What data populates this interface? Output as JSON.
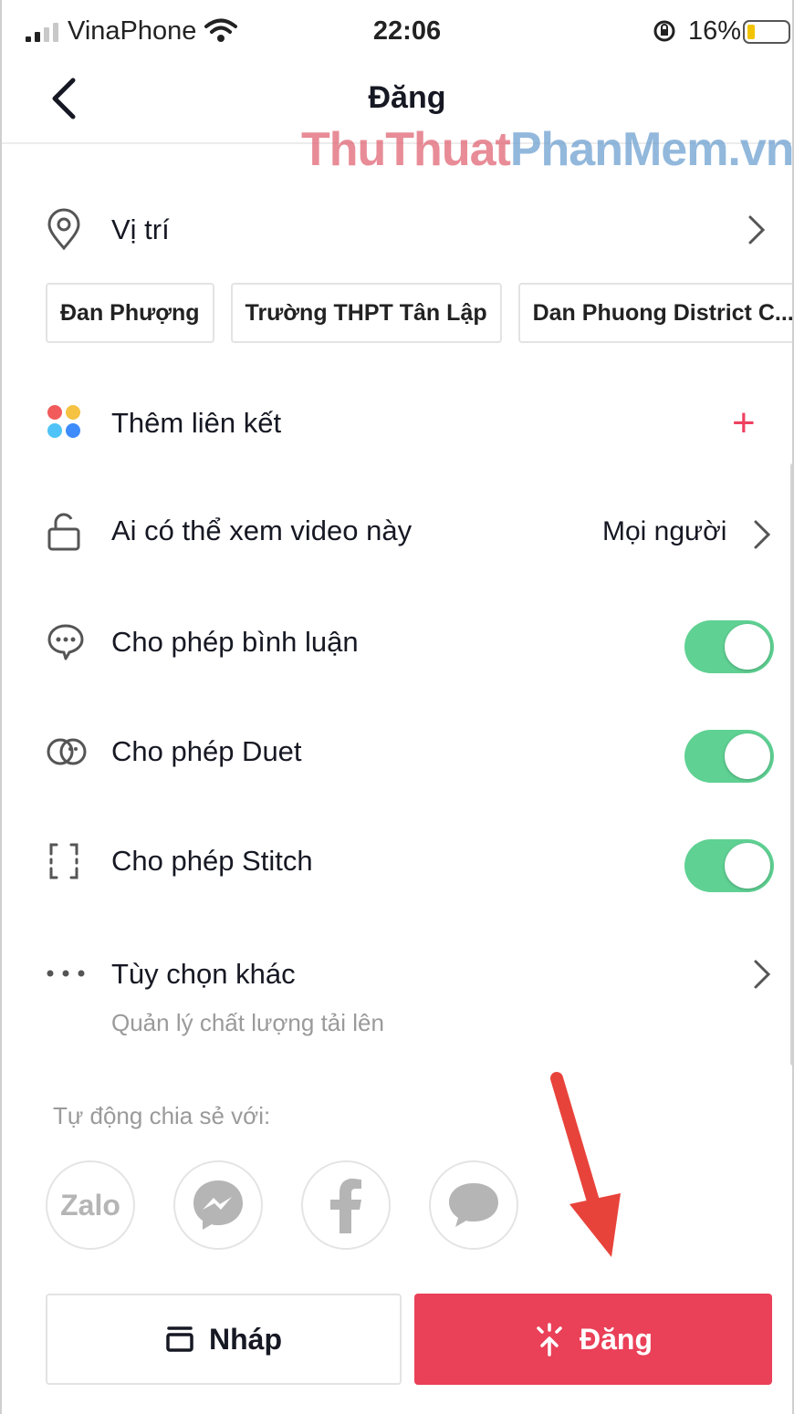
{
  "status_bar": {
    "carrier": "VinaPhone",
    "time": "22:06",
    "battery_percent": "16%",
    "battery_level": 0.16
  },
  "nav": {
    "title": "Đăng",
    "back_icon": "chevron-left-icon"
  },
  "watermark": {
    "part1": "ThuThuat",
    "part2": "PhanMem.vn"
  },
  "location": {
    "label": "Vị trí",
    "icon": "location-pin-icon",
    "suggestions": [
      "Đan Phượng",
      "Trường THPT Tân Lập",
      "Dan Phuong District C..."
    ]
  },
  "add_link": {
    "label": "Thêm liên kết",
    "icon": "colored-dots-icon",
    "action_icon": "plus-icon",
    "dot_colors": [
      "#f15b5b",
      "#f5c242",
      "#4fc3f7",
      "#3d8bfd"
    ]
  },
  "privacy": {
    "label": "Ai có thể xem video này",
    "value": "Mọi người",
    "icon": "lock-open-icon"
  },
  "toggles": [
    {
      "label": "Cho phép bình luận",
      "icon": "comment-icon",
      "on": true
    },
    {
      "label": "Cho phép Duet",
      "icon": "duet-icon",
      "on": true
    },
    {
      "label": "Cho phép Stitch",
      "icon": "stitch-icon",
      "on": true
    }
  ],
  "more_options": {
    "label": "Tùy chọn khác",
    "sublabel": "Quản lý chất lượng tải lên",
    "icon": "more-dots-icon"
  },
  "share": {
    "label": "Tự động chia sẻ với:",
    "targets": [
      {
        "name": "zalo-icon",
        "text": "Zalo"
      },
      {
        "name": "messenger-icon"
      },
      {
        "name": "facebook-icon"
      },
      {
        "name": "message-icon"
      }
    ]
  },
  "actions": {
    "draft_label": "Nháp",
    "post_label": "Đăng"
  },
  "colors": {
    "accent": "#ea4058",
    "toggle_on": "#5fd193",
    "plus": "#ee4160",
    "arrow": "#e8433b"
  }
}
